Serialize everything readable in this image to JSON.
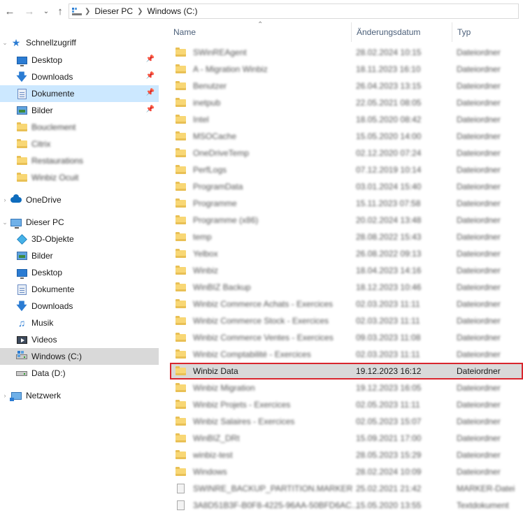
{
  "address": {
    "back_icon": "back-arrow-icon",
    "forward_icon": "forward-arrow-icon",
    "recent_icon": "chevron-down-icon",
    "up_icon": "up-arrow-icon",
    "path": [
      "Dieser PC",
      "Windows (C:)"
    ]
  },
  "sidebar": {
    "quick": {
      "label": "Schnellzugriff"
    },
    "quick_items": [
      {
        "label": "Desktop",
        "icon": "desktop-icon",
        "pinned": true
      },
      {
        "label": "Downloads",
        "icon": "downloads-icon",
        "pinned": true
      },
      {
        "label": "Dokumente",
        "icon": "documents-icon",
        "pinned": true
      },
      {
        "label": "Bilder",
        "icon": "pictures-icon",
        "pinned": true
      },
      {
        "label": "Bouclement",
        "icon": "folder-icon",
        "pinned": false
      },
      {
        "label": "Citrix",
        "icon": "folder-icon",
        "pinned": false
      },
      {
        "label": "Restaurations",
        "icon": "folder-icon",
        "pinned": false
      },
      {
        "label": "Winbiz Ocuit",
        "icon": "folder-icon",
        "pinned": false
      }
    ],
    "onedrive": {
      "label": "OneDrive"
    },
    "pc": {
      "label": "Dieser PC"
    },
    "pc_items": [
      {
        "label": "3D-Objekte",
        "icon": "3d-objects-icon"
      },
      {
        "label": "Bilder",
        "icon": "pictures-icon"
      },
      {
        "label": "Desktop",
        "icon": "desktop-icon"
      },
      {
        "label": "Dokumente",
        "icon": "documents-icon"
      },
      {
        "label": "Downloads",
        "icon": "downloads-icon"
      },
      {
        "label": "Musik",
        "icon": "music-icon"
      },
      {
        "label": "Videos",
        "icon": "videos-icon"
      },
      {
        "label": "Windows (C:)",
        "icon": "drive-c-icon"
      },
      {
        "label": "Data (D:)",
        "icon": "drive-icon"
      }
    ],
    "network": {
      "label": "Netzwerk"
    }
  },
  "content": {
    "columns": {
      "name": "Name",
      "date": "Änderungsdatum",
      "type": "Typ"
    },
    "files": [
      {
        "name": "SWinREAgent",
        "date": "28.02.2024 10:15",
        "type": "Dateiordner",
        "kind": "folder"
      },
      {
        "name": "A - Migration Winbiz",
        "date": "18.11.2023 16:10",
        "type": "Dateiordner",
        "kind": "folder"
      },
      {
        "name": "Benutzer",
        "date": "26.04.2023 13:15",
        "type": "Dateiordner",
        "kind": "folder"
      },
      {
        "name": "inetpub",
        "date": "22.05.2021 08:05",
        "type": "Dateiordner",
        "kind": "folder"
      },
      {
        "name": "Intel",
        "date": "18.05.2020 08:42",
        "type": "Dateiordner",
        "kind": "folder"
      },
      {
        "name": "MSOCache",
        "date": "15.05.2020 14:00",
        "date2": "",
        "type": "Dateiordner",
        "kind": "folder"
      },
      {
        "name": "OneDriveTemp",
        "date": "02.12.2020 07:24",
        "type": "Dateiordner",
        "kind": "folder"
      },
      {
        "name": "PerfLogs",
        "date": "07.12.2019 10:14",
        "type": "Dateiordner",
        "kind": "folder"
      },
      {
        "name": "ProgramData",
        "date": "03.01.2024 15:40",
        "type": "Dateiordner",
        "kind": "folder"
      },
      {
        "name": "Programme",
        "date": "15.11.2023 07:58",
        "type": "Dateiordner",
        "kind": "folder"
      },
      {
        "name": "Programme (x86)",
        "date": "20.02.2024 13:48",
        "type": "Dateiordner",
        "kind": "folder"
      },
      {
        "name": "temp",
        "date": "28.08.2022 15:43",
        "type": "Dateiordner",
        "kind": "folder"
      },
      {
        "name": "Yelbox",
        "date": "26.08.2022 09:13",
        "type": "Dateiordner",
        "kind": "folder"
      },
      {
        "name": "Winbiz",
        "date": "18.04.2023 14:16",
        "type": "Dateiordner",
        "kind": "folder"
      },
      {
        "name": "WinBIZ Backup",
        "date": "18.12.2023 10:46",
        "type": "Dateiordner",
        "kind": "folder"
      },
      {
        "name": "Winbiz Commerce Achats - Exercices",
        "date": "02.03.2023 11:11",
        "type": "Dateiordner",
        "kind": "folder"
      },
      {
        "name": "Winbiz Commerce Stock - Exercices",
        "date": "02.03.2023 11:11",
        "type": "Dateiordner",
        "kind": "folder"
      },
      {
        "name": "Winbiz Commerce Ventes - Exercices",
        "date": "09.03.2023 11:08",
        "type": "Dateiordner",
        "kind": "folder"
      },
      {
        "name": "Winbiz Comptabilité - Exercices",
        "date": "02.03.2023 11:11",
        "type": "Dateiordner",
        "kind": "folder"
      },
      {
        "name": "Winbiz Data",
        "date": "19.12.2023 16:12",
        "type": "Dateiordner",
        "kind": "folder",
        "highlighted": true
      },
      {
        "name": "Winbiz Migration",
        "date": "19.12.2023 16:05",
        "type": "Dateiordner",
        "kind": "folder"
      },
      {
        "name": "Winbiz Projets - Exercices",
        "date": "02.05.2023 11:11",
        "type": "Dateiordner",
        "kind": "folder"
      },
      {
        "name": "Winbiz Salaires - Exercices",
        "date": "02.05.2023 15:07",
        "type": "Dateiordner",
        "kind": "folder"
      },
      {
        "name": "WinBIZ_DRt",
        "date": "15.09.2021 17:00",
        "type": "Dateiordner",
        "kind": "folder"
      },
      {
        "name": "winbiz-test",
        "date": "28.05.2023 15:29",
        "type": "Dateiordner",
        "kind": "folder"
      },
      {
        "name": "Windows",
        "date": "28.02.2024 10:09",
        "type": "Dateiordner",
        "kind": "folder"
      },
      {
        "name": "SWINRE_BACKUP_PARTITION.MARKER",
        "date": "25.02.2021 21:42",
        "type": "MARKER-Datei",
        "kind": "file"
      },
      {
        "name": "3A8D51B3F-B0F8-4225-96AA-50BFD6AC...",
        "date": "15.05.2020 13:55",
        "type": "Textdokument",
        "kind": "file"
      }
    ]
  },
  "colors": {
    "selected": "#cce8ff",
    "active": "#d9d9d9",
    "highlight_border": "#d9262e",
    "folder": "#f8d775"
  }
}
